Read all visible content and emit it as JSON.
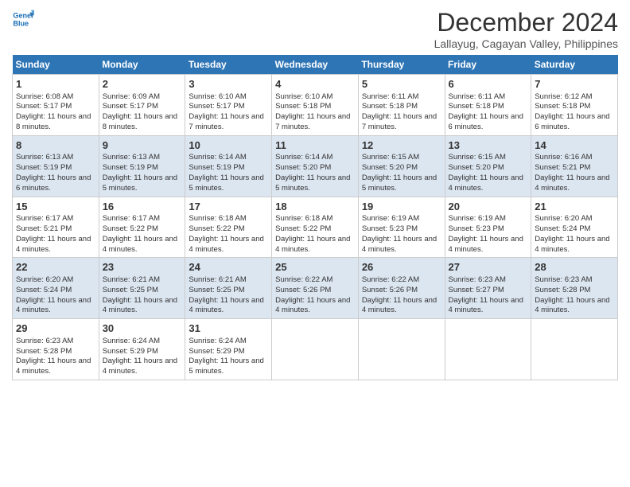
{
  "header": {
    "logo_line1": "General",
    "logo_line2": "Blue",
    "title": "December 2024",
    "subtitle": "Lallayug, Cagayan Valley, Philippines"
  },
  "days_of_week": [
    "Sunday",
    "Monday",
    "Tuesday",
    "Wednesday",
    "Thursday",
    "Friday",
    "Saturday"
  ],
  "weeks": [
    [
      {
        "day": "1",
        "info": "Sunrise: 6:08 AM\nSunset: 5:17 PM\nDaylight: 11 hours and 8 minutes."
      },
      {
        "day": "2",
        "info": "Sunrise: 6:09 AM\nSunset: 5:17 PM\nDaylight: 11 hours and 8 minutes."
      },
      {
        "day": "3",
        "info": "Sunrise: 6:10 AM\nSunset: 5:17 PM\nDaylight: 11 hours and 7 minutes."
      },
      {
        "day": "4",
        "info": "Sunrise: 6:10 AM\nSunset: 5:18 PM\nDaylight: 11 hours and 7 minutes."
      },
      {
        "day": "5",
        "info": "Sunrise: 6:11 AM\nSunset: 5:18 PM\nDaylight: 11 hours and 7 minutes."
      },
      {
        "day": "6",
        "info": "Sunrise: 6:11 AM\nSunset: 5:18 PM\nDaylight: 11 hours and 6 minutes."
      },
      {
        "day": "7",
        "info": "Sunrise: 6:12 AM\nSunset: 5:18 PM\nDaylight: 11 hours and 6 minutes."
      }
    ],
    [
      {
        "day": "8",
        "info": "Sunrise: 6:13 AM\nSunset: 5:19 PM\nDaylight: 11 hours and 6 minutes."
      },
      {
        "day": "9",
        "info": "Sunrise: 6:13 AM\nSunset: 5:19 PM\nDaylight: 11 hours and 5 minutes."
      },
      {
        "day": "10",
        "info": "Sunrise: 6:14 AM\nSunset: 5:19 PM\nDaylight: 11 hours and 5 minutes."
      },
      {
        "day": "11",
        "info": "Sunrise: 6:14 AM\nSunset: 5:20 PM\nDaylight: 11 hours and 5 minutes."
      },
      {
        "day": "12",
        "info": "Sunrise: 6:15 AM\nSunset: 5:20 PM\nDaylight: 11 hours and 5 minutes."
      },
      {
        "day": "13",
        "info": "Sunrise: 6:15 AM\nSunset: 5:20 PM\nDaylight: 11 hours and 4 minutes."
      },
      {
        "day": "14",
        "info": "Sunrise: 6:16 AM\nSunset: 5:21 PM\nDaylight: 11 hours and 4 minutes."
      }
    ],
    [
      {
        "day": "15",
        "info": "Sunrise: 6:17 AM\nSunset: 5:21 PM\nDaylight: 11 hours and 4 minutes."
      },
      {
        "day": "16",
        "info": "Sunrise: 6:17 AM\nSunset: 5:22 PM\nDaylight: 11 hours and 4 minutes."
      },
      {
        "day": "17",
        "info": "Sunrise: 6:18 AM\nSunset: 5:22 PM\nDaylight: 11 hours and 4 minutes."
      },
      {
        "day": "18",
        "info": "Sunrise: 6:18 AM\nSunset: 5:22 PM\nDaylight: 11 hours and 4 minutes."
      },
      {
        "day": "19",
        "info": "Sunrise: 6:19 AM\nSunset: 5:23 PM\nDaylight: 11 hours and 4 minutes."
      },
      {
        "day": "20",
        "info": "Sunrise: 6:19 AM\nSunset: 5:23 PM\nDaylight: 11 hours and 4 minutes."
      },
      {
        "day": "21",
        "info": "Sunrise: 6:20 AM\nSunset: 5:24 PM\nDaylight: 11 hours and 4 minutes."
      }
    ],
    [
      {
        "day": "22",
        "info": "Sunrise: 6:20 AM\nSunset: 5:24 PM\nDaylight: 11 hours and 4 minutes."
      },
      {
        "day": "23",
        "info": "Sunrise: 6:21 AM\nSunset: 5:25 PM\nDaylight: 11 hours and 4 minutes."
      },
      {
        "day": "24",
        "info": "Sunrise: 6:21 AM\nSunset: 5:25 PM\nDaylight: 11 hours and 4 minutes."
      },
      {
        "day": "25",
        "info": "Sunrise: 6:22 AM\nSunset: 5:26 PM\nDaylight: 11 hours and 4 minutes."
      },
      {
        "day": "26",
        "info": "Sunrise: 6:22 AM\nSunset: 5:26 PM\nDaylight: 11 hours and 4 minutes."
      },
      {
        "day": "27",
        "info": "Sunrise: 6:23 AM\nSunset: 5:27 PM\nDaylight: 11 hours and 4 minutes."
      },
      {
        "day": "28",
        "info": "Sunrise: 6:23 AM\nSunset: 5:28 PM\nDaylight: 11 hours and 4 minutes."
      }
    ],
    [
      {
        "day": "29",
        "info": "Sunrise: 6:23 AM\nSunset: 5:28 PM\nDaylight: 11 hours and 4 minutes."
      },
      {
        "day": "30",
        "info": "Sunrise: 6:24 AM\nSunset: 5:29 PM\nDaylight: 11 hours and 4 minutes."
      },
      {
        "day": "31",
        "info": "Sunrise: 6:24 AM\nSunset: 5:29 PM\nDaylight: 11 hours and 5 minutes."
      },
      null,
      null,
      null,
      null
    ]
  ]
}
